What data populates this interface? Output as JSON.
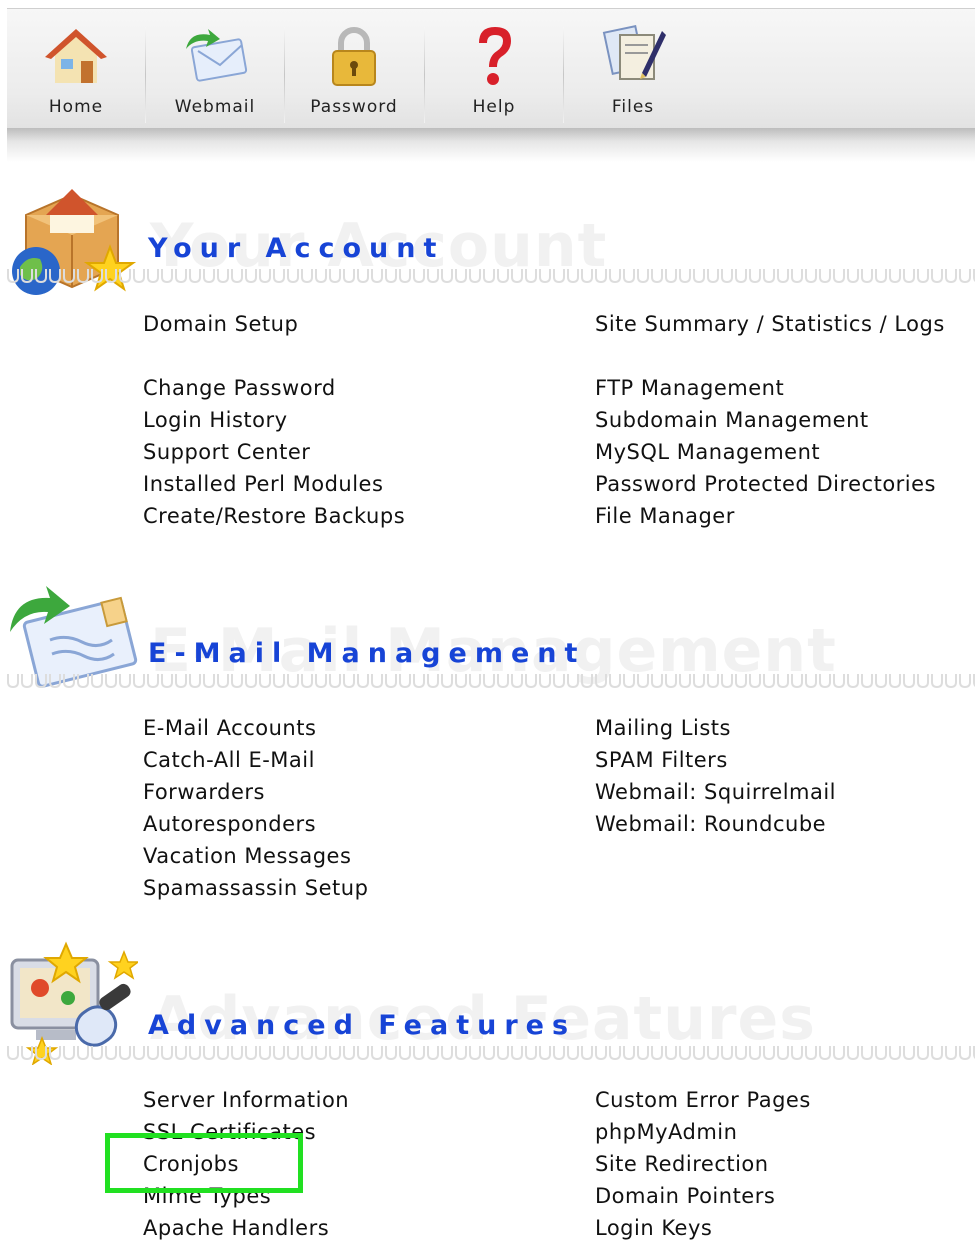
{
  "toolbar": {
    "items": [
      {
        "label": "Home",
        "icon": "home-icon"
      },
      {
        "label": "Webmail",
        "icon": "webmail-icon"
      },
      {
        "label": "Password",
        "icon": "padlock-icon"
      },
      {
        "label": "Help",
        "icon": "question-mark-icon"
      },
      {
        "label": "Files",
        "icon": "files-icon"
      }
    ]
  },
  "sections": {
    "account": {
      "title": "Your Account",
      "watermark": "Your Account",
      "icon": "package-globe-star-icon",
      "left": [
        "Domain Setup",
        "",
        "Change Password",
        "Login History",
        "Support Center",
        "Installed Perl Modules",
        "Create/Restore Backups"
      ],
      "right": [
        "Site Summary / Statistics / Logs",
        "",
        "FTP Management",
        "Subdomain Management",
        "MySQL Management",
        "Password Protected Directories",
        "File Manager"
      ]
    },
    "email": {
      "title": "E-Mail Management",
      "watermark": "E-Mail Management",
      "icon": "envelope-arrow-icon",
      "left": [
        "E-Mail Accounts",
        "Catch-All E-Mail",
        "Forwarders",
        "Autoresponders",
        "Vacation Messages",
        "Spamassassin Setup"
      ],
      "right": [
        "Mailing Lists",
        "SPAM Filters",
        "Webmail: Squirrelmail",
        "Webmail: Roundcube"
      ]
    },
    "advanced": {
      "title": "Advanced Features",
      "watermark": "Advanced Features",
      "icon": "monitor-magnifier-star-icon",
      "left": [
        "Server Information",
        "SSL Certificates",
        "Cronjobs",
        "Mime Types",
        "Apache Handlers"
      ],
      "right": [
        "Custom Error Pages",
        "phpMyAdmin",
        "Site Redirection",
        "Domain Pointers",
        "Login Keys"
      ]
    }
  },
  "highlight": {
    "target": "Cronjobs",
    "color": "#21e021"
  },
  "colors": {
    "title": "#1744d6",
    "watermark": "#f1f1f1",
    "highlight": "#21e021"
  }
}
